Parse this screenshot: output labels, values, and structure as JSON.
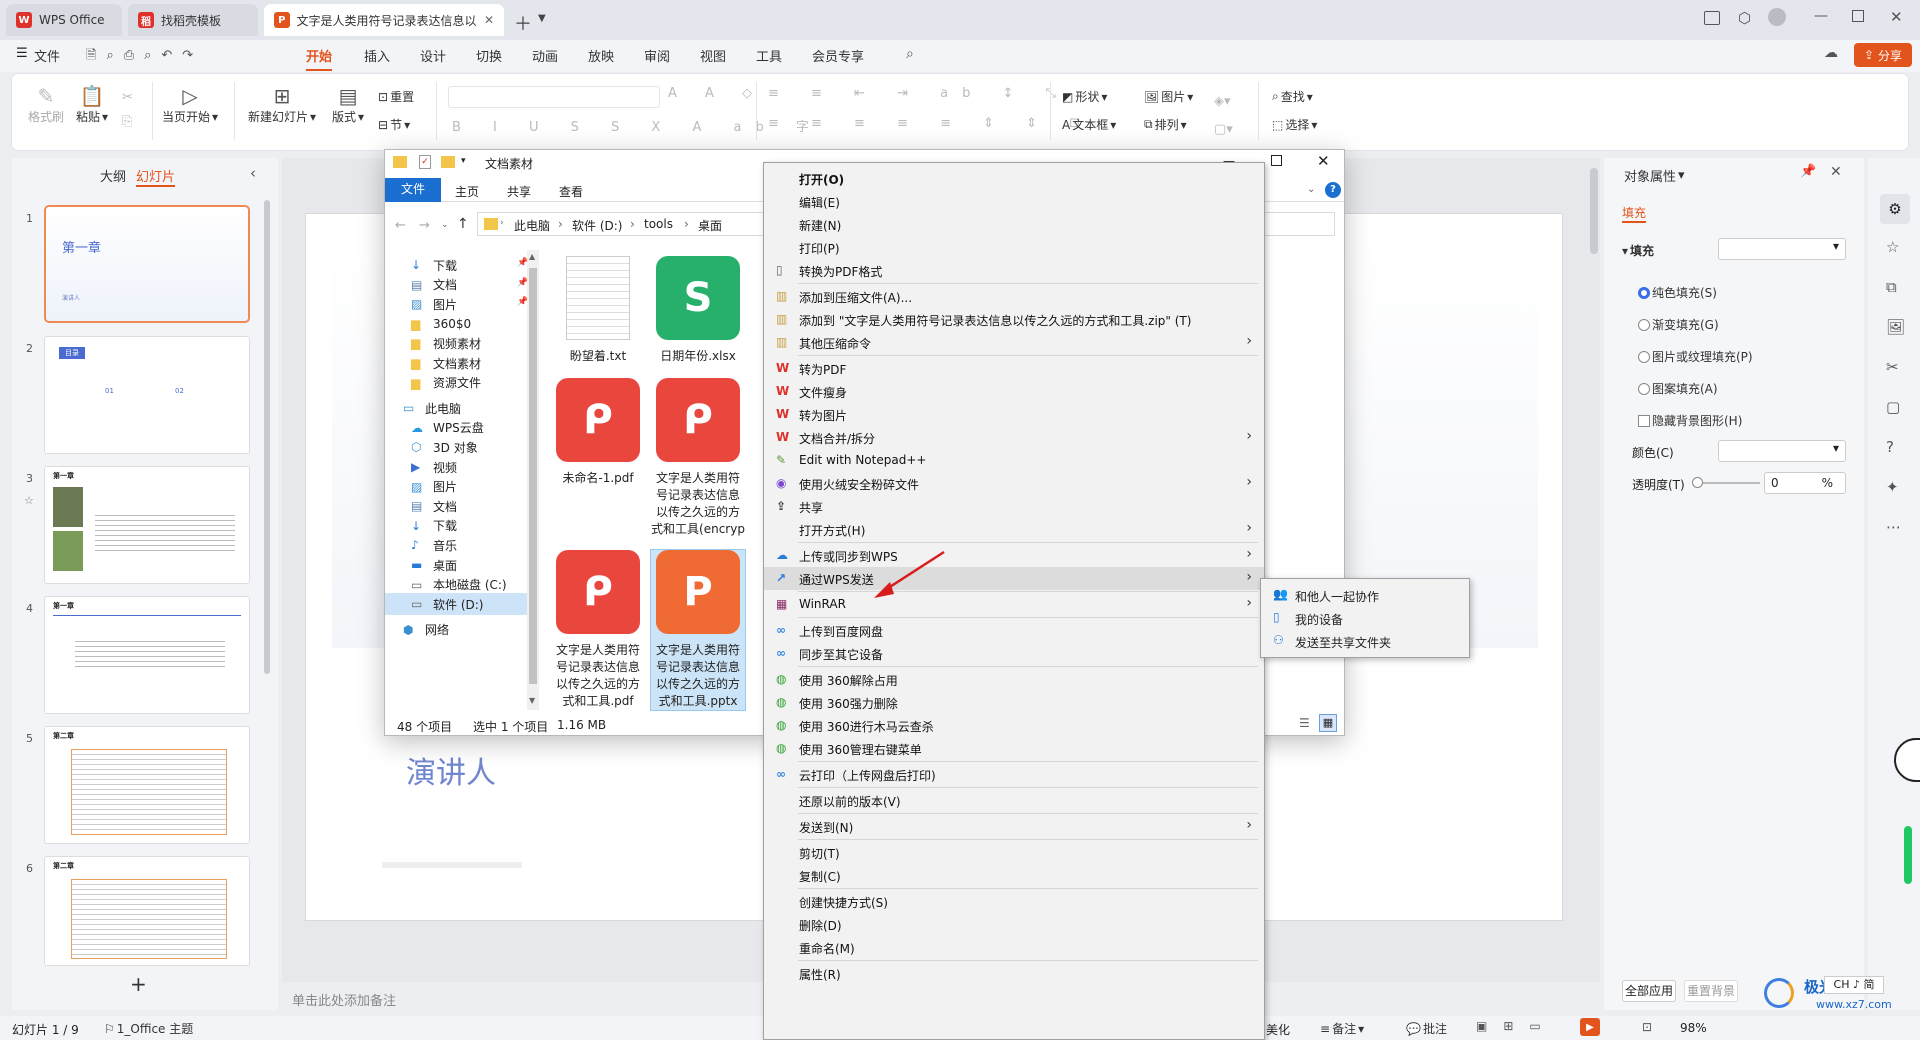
{
  "tabs": [
    {
      "label": "WPS Office"
    },
    {
      "label": "找稻壳模板"
    },
    {
      "label": "文字是人类用符号记录表达信息以..."
    }
  ],
  "menubar": {
    "file": "文件",
    "items": [
      "开始",
      "插入",
      "设计",
      "切换",
      "动画",
      "放映",
      "审阅",
      "视图",
      "工具",
      "会员专享"
    ],
    "active": "开始",
    "share": "分享"
  },
  "ribbon": {
    "format_painter": "格式刷",
    "paste": "粘贴",
    "play_from_current": "当页开始",
    "new_slide": "新建幻灯片",
    "layout": "版式",
    "section": "节",
    "reset": "重置",
    "shape": "形状",
    "picture": "图片",
    "textbox": "文本框",
    "arrange": "排列",
    "find": "查找",
    "select": "选择"
  },
  "left_pane": {
    "tab_outline": "大纲",
    "tab_slides": "幻灯片",
    "slides": [
      {
        "num": "1",
        "title": "第一章",
        "subtitle": "演讲人"
      },
      {
        "num": "2",
        "title": "目录",
        "items": [
          "01",
          "02"
        ]
      },
      {
        "num": "3",
        "title": "第一章"
      },
      {
        "num": "4",
        "title": "第一章"
      },
      {
        "num": "5",
        "title": "第二章"
      },
      {
        "num": "6",
        "title": "第二章"
      }
    ],
    "add": "+"
  },
  "canvas": {
    "speaker": "演讲人",
    "notes_placeholder": "单击此处添加备注"
  },
  "right_pane": {
    "title": "对象属性",
    "tab_fill": "填充",
    "section_fill": "填充",
    "options": [
      "纯色填充(S)",
      "渐变填充(G)",
      "图片或纹理填充(P)",
      "图案填充(A)"
    ],
    "hide_bg": "隐藏背景图形(H)",
    "color_label": "颜色(C)",
    "transparency_label": "透明度(T)",
    "transparency_value": "0",
    "transparency_unit": "%",
    "apply_all": "全部应用",
    "reset_bg": "重置背景"
  },
  "status": {
    "slide": "幻灯片 1 / 9",
    "theme": "1_Office 主题",
    "beautify": "美化",
    "notes": "备注",
    "comments": "批注",
    "zoom": "98%"
  },
  "explorer": {
    "title": "文档素材",
    "ribbon_tabs": [
      "文件",
      "主页",
      "共享",
      "查看"
    ],
    "breadcrumb": [
      "此电脑",
      "软件 (D:)",
      "tools",
      "桌面"
    ],
    "nav": [
      {
        "label": "下载",
        "icon": "download-icon",
        "pinned": true
      },
      {
        "label": "文档",
        "icon": "document-icon",
        "pinned": true
      },
      {
        "label": "图片",
        "icon": "picture-icon",
        "pinned": true
      },
      {
        "label": "360$0",
        "icon": "folder-icon"
      },
      {
        "label": "视频素材",
        "icon": "folder-icon"
      },
      {
        "label": "文档素材",
        "icon": "folder-icon"
      },
      {
        "label": "资源文件",
        "icon": "folder-icon"
      },
      {
        "label": "此电脑",
        "icon": "computer-icon",
        "root": true
      },
      {
        "label": "WPS云盘",
        "icon": "cloud-icon"
      },
      {
        "label": "3D 对象",
        "icon": "cube-icon"
      },
      {
        "label": "视频",
        "icon": "video-icon"
      },
      {
        "label": "图片",
        "icon": "picture-icon"
      },
      {
        "label": "文档",
        "icon": "document-icon"
      },
      {
        "label": "下载",
        "icon": "download-icon"
      },
      {
        "label": "音乐",
        "icon": "music-icon"
      },
      {
        "label": "桌面",
        "icon": "desktop-icon"
      },
      {
        "label": "本地磁盘 (C:)",
        "icon": "drive-icon"
      },
      {
        "label": "软件 (D:)",
        "icon": "drive-icon",
        "selected": true
      },
      {
        "label": "网络",
        "icon": "network-icon",
        "root": true
      }
    ],
    "files": [
      {
        "name": "盼望着.txt",
        "type": "txt"
      },
      {
        "name": "日期年份.xlsx",
        "type": "xlsx"
      },
      {
        "name": "未命名-1.pdf",
        "type": "pdf"
      },
      {
        "name": "文字是人类用符号记录表达信息以传之久远的方式和工具(encrypted)",
        "type": "pdf"
      },
      {
        "name": "文字是人类用符号记录表达信息以传之久远的方式和工具.pdf",
        "type": "pdf"
      },
      {
        "name": "文字是人类用符号记录表达信息以传之久远的方式和工具.pptx",
        "type": "pptx",
        "selected": true
      }
    ],
    "status": {
      "count": "48 个项目",
      "selected": "选中 1 个项目",
      "size": "1.16 MB"
    }
  },
  "context_menu": {
    "items": [
      {
        "label": "打开(O)",
        "icon": "",
        "bold": true
      },
      {
        "label": "编辑(E)",
        "icon": ""
      },
      {
        "label": "新建(N)",
        "icon": ""
      },
      {
        "label": "打印(P)",
        "icon": ""
      },
      {
        "label": "转换为PDF格式",
        "icon": "file-icon"
      },
      {
        "sep": true
      },
      {
        "label": "添加到压缩文件(A)...",
        "icon": "archive-icon"
      },
      {
        "label": "添加到 \"文字是人类用符号记录表达信息以传之久远的方式和工具.zip\" (T)",
        "icon": "archive-icon"
      },
      {
        "label": "其他压缩命令",
        "icon": "archive-icon",
        "sub": true
      },
      {
        "sep": true
      },
      {
        "label": "转为PDF",
        "icon": "wps-icon"
      },
      {
        "label": "文件瘦身",
        "icon": "wps-icon"
      },
      {
        "label": "转为图片",
        "icon": "wps-icon"
      },
      {
        "label": "文档合并/拆分",
        "icon": "wps-icon",
        "sub": true
      },
      {
        "label": "Edit with Notepad++",
        "icon": "notepad-icon"
      },
      {
        "label": "使用火绒安全粉碎文件",
        "icon": "huorong-icon",
        "sub": true
      },
      {
        "label": "共享",
        "icon": "share-icon"
      },
      {
        "label": "打开方式(H)",
        "icon": "",
        "sub": true
      },
      {
        "sep": true
      },
      {
        "label": "上传或同步到WPS",
        "icon": "cloud-icon",
        "sub": true
      },
      {
        "label": "通过WPS发送",
        "icon": "send-icon",
        "sub": true,
        "hover": true
      },
      {
        "sep": true
      },
      {
        "label": "WinRAR",
        "icon": "winrar-icon",
        "sub": true
      },
      {
        "sep": true
      },
      {
        "label": "上传到百度网盘",
        "icon": "baidu-icon"
      },
      {
        "label": "同步至其它设备",
        "icon": "baidu-icon"
      },
      {
        "sep": true
      },
      {
        "label": "使用 360解除占用",
        "icon": "360-icon"
      },
      {
        "label": "使用 360强力删除",
        "icon": "360-icon"
      },
      {
        "label": "使用 360进行木马云查杀",
        "icon": "360-icon"
      },
      {
        "label": "使用 360管理右键菜单",
        "icon": "360-icon"
      },
      {
        "sep": true
      },
      {
        "label": "云打印（上传网盘后打印)",
        "icon": "baidu-icon"
      },
      {
        "sep": true
      },
      {
        "label": "还原以前的版本(V)",
        "icon": ""
      },
      {
        "sep": true
      },
      {
        "label": "发送到(N)",
        "icon": "",
        "sub": true
      },
      {
        "sep": true
      },
      {
        "label": "剪切(T)",
        "icon": ""
      },
      {
        "label": "复制(C)",
        "icon": ""
      },
      {
        "sep": true
      },
      {
        "label": "创建快捷方式(S)",
        "icon": ""
      },
      {
        "label": "删除(D)",
        "icon": ""
      },
      {
        "label": "重命名(M)",
        "icon": ""
      },
      {
        "sep": true
      },
      {
        "label": "属性(R)",
        "icon": ""
      }
    ]
  },
  "submenu": {
    "items": [
      {
        "label": "和他人一起协作",
        "icon": "people-icon"
      },
      {
        "label": "我的设备",
        "icon": "device-icon"
      },
      {
        "label": "发送至共享文件夹",
        "icon": "shared-folder-icon"
      }
    ]
  },
  "watermark": {
    "text": "极光下载站",
    "url": "www.xz7.com"
  },
  "ime": "CH ♪ 简"
}
